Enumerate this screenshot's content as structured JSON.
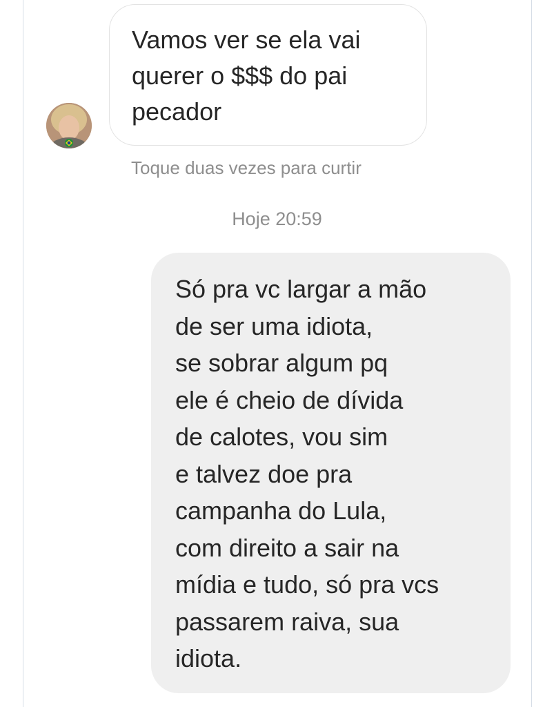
{
  "conversation": {
    "incoming_message": {
      "text": "Vamos ver se ela vai\nquerer o $$$ do pai\npecador",
      "sender_avatar": "profile-photo-icon"
    },
    "like_hint": "Toque duas vezes para curtir",
    "timestamp": "Hoje 20:59",
    "outgoing_message": {
      "text": "Só pra vc largar a mão\nde ser uma idiota,\nse sobrar algum pq\nele é cheio de dívida\nde calotes, vou sim\ne talvez doe pra\ncampanha do Lula,\ncom direito a sair na\nmídia e tudo, só pra vcs\npassarem raiva, sua\nidiota."
    }
  },
  "colors": {
    "background": "#ffffff",
    "incoming_bubble_border": "#e3e3e3",
    "outgoing_bubble_bg": "#efefef",
    "message_text": "#262626",
    "meta_text": "#8e8e8e"
  }
}
